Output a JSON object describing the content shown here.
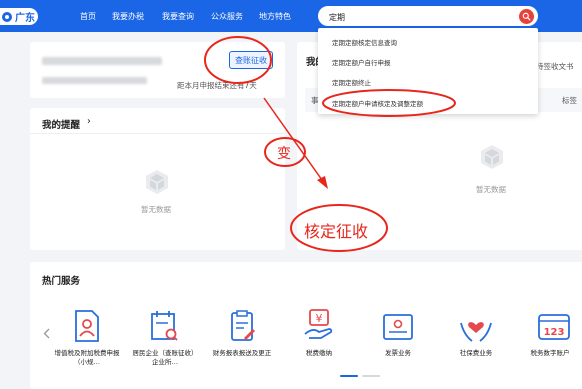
{
  "header": {
    "region": "广东",
    "nav": [
      "首页",
      "我要办税",
      "我要查询",
      "公众服务",
      "地方特色"
    ],
    "search_value": "定期"
  },
  "search_dropdown": {
    "items": [
      "定期定额核定信息查询",
      "定期定额户自行申报",
      "定期定额终止",
      "定期定额户申请核定及调整定额"
    ]
  },
  "account_card": {
    "button": "查账征收",
    "deadline_text": "距本月申报结束还有7天"
  },
  "right_card": {
    "title": "我的",
    "top_right": "待签收文书",
    "tab_left": "事",
    "tab_right": "标签",
    "empty_text": "暂无数据"
  },
  "reminder": {
    "title": "我的提醒",
    "chevron": "›",
    "empty_text": "暂无数据"
  },
  "hot_services": {
    "title": "热门服务",
    "items": [
      {
        "label": "增值税及附加税费申报（小规…",
        "icon": "person-doc-icon"
      },
      {
        "label": "居民企业（查账征收）企业所…",
        "icon": "calendar-search-icon"
      },
      {
        "label": "财务报表报送及更正",
        "icon": "clipboard-edit-icon"
      },
      {
        "label": "税费缴纳",
        "icon": "yuan-hand-icon"
      },
      {
        "label": "发票业务",
        "icon": "invoice-icon"
      },
      {
        "label": "社保费业务",
        "icon": "heart-hands-icon"
      },
      {
        "label": "税务数字账户",
        "icon": "digital-123-icon"
      }
    ]
  },
  "annotations": {
    "change": "变",
    "result": "核定征收"
  },
  "colors": {
    "brand_blue": "#1a66e6",
    "annotation_red": "#e8261c",
    "service_blue": "#2a6fdb",
    "service_red": "#e5484d"
  }
}
